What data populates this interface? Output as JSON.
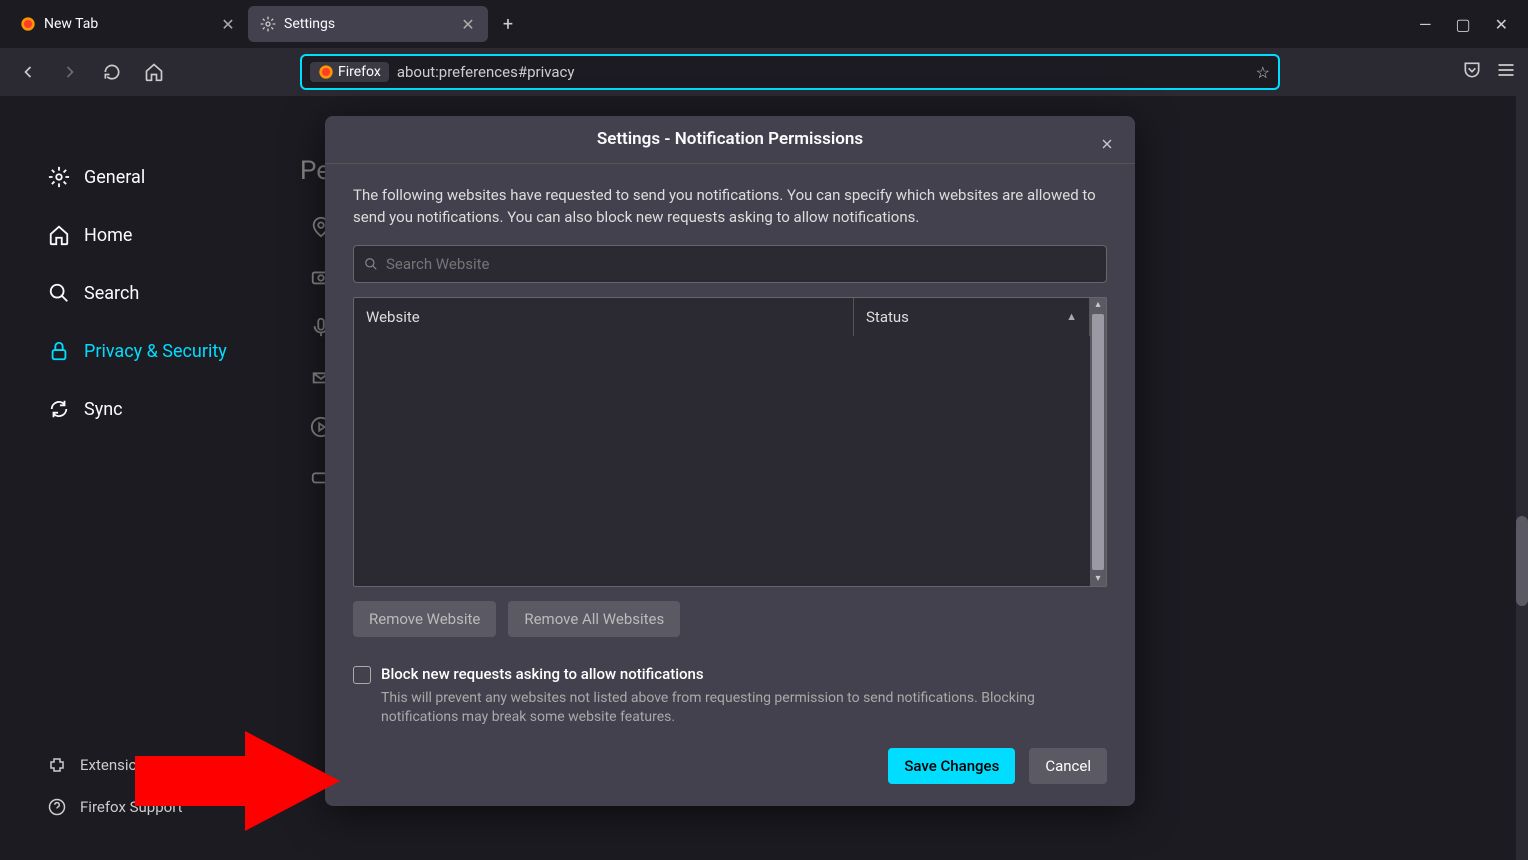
{
  "tabs": [
    {
      "title": "New Tab",
      "active": false
    },
    {
      "title": "Settings",
      "active": true
    }
  ],
  "window_controls": {
    "minimize": "—",
    "maximize": "▢",
    "close": "✕"
  },
  "toolbar": {
    "identity_label": "Firefox",
    "url_text": "about:preferences#privacy"
  },
  "sidebar": {
    "items": [
      {
        "label": "General",
        "icon": "gear"
      },
      {
        "label": "Home",
        "icon": "home"
      },
      {
        "label": "Search",
        "icon": "search"
      },
      {
        "label": "Privacy & Security",
        "icon": "lock",
        "active": true
      },
      {
        "label": "Sync",
        "icon": "sync"
      }
    ],
    "footer": [
      {
        "label": "Extensions & Themes",
        "icon": "puzzle"
      },
      {
        "label": "Firefox Support",
        "icon": "help"
      }
    ]
  },
  "bg_panel": {
    "title_fragment": "Pe"
  },
  "modal": {
    "title": "Settings - Notification Permissions",
    "description": "The following websites have requested to send you notifications. You can specify which websites are allowed to send you notifications. You can also block new requests asking to allow notifications.",
    "search_placeholder": "Search Website",
    "table": {
      "col_website": "Website",
      "col_status": "Status"
    },
    "remove_website_btn": "Remove Website",
    "remove_all_btn": "Remove All Websites",
    "block_checkbox_label": "Block new requests asking to allow notifications",
    "block_checkbox_sub": "This will prevent any websites not listed above from requesting permission to send notifications. Blocking notifications may break some website features.",
    "save_btn": "Save Changes",
    "cancel_btn": "Cancel"
  },
  "annotation": {
    "arrow_color": "#ff0000"
  }
}
